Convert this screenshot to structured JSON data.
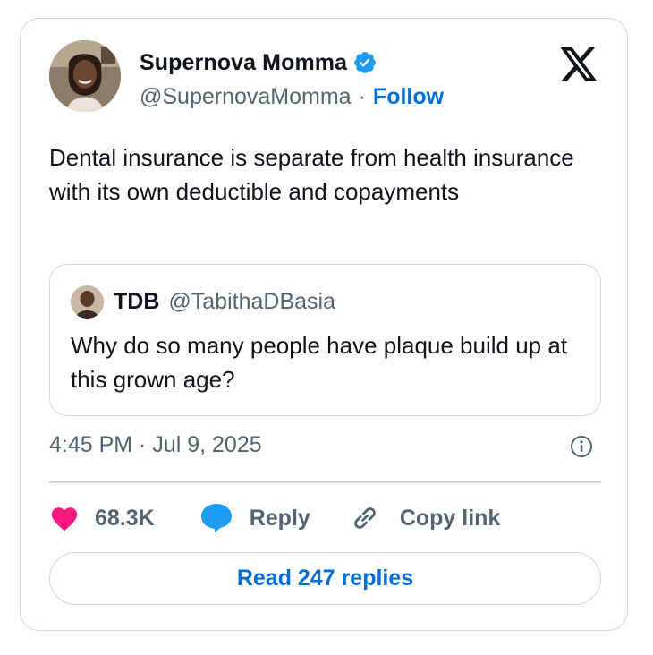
{
  "tweet": {
    "author": {
      "name": "Supernova Momma",
      "handle": "@SupernovaMomma",
      "separator": "·",
      "follow_label": "Follow",
      "verified": true
    },
    "brand_icon": "x-logo-icon",
    "text": "Dental insurance is separate from health insurance with its own deductible and copayments",
    "quoted": {
      "name": "TDB",
      "handle": "@TabithaDBasia",
      "text": "Why do so many people have plaque build up at this grown age?"
    },
    "timestamp": "4:45 PM · Jul 9, 2025",
    "actions": {
      "like_count": "68.3K",
      "reply_label": "Reply",
      "copy_link_label": "Copy link"
    },
    "read_replies_label": "Read 247 replies"
  },
  "colors": {
    "accent": "#006fd6",
    "verified_badge": "#1d9bf0",
    "like": "#f91880",
    "reply_icon": "#1d9bf0",
    "text_primary": "#0f1419",
    "text_secondary": "#536471",
    "border": "#cfd9de"
  },
  "icons": [
    "verified-badge-icon",
    "x-logo-icon",
    "info-icon",
    "heart-icon",
    "reply-bubble-icon",
    "link-icon"
  ]
}
